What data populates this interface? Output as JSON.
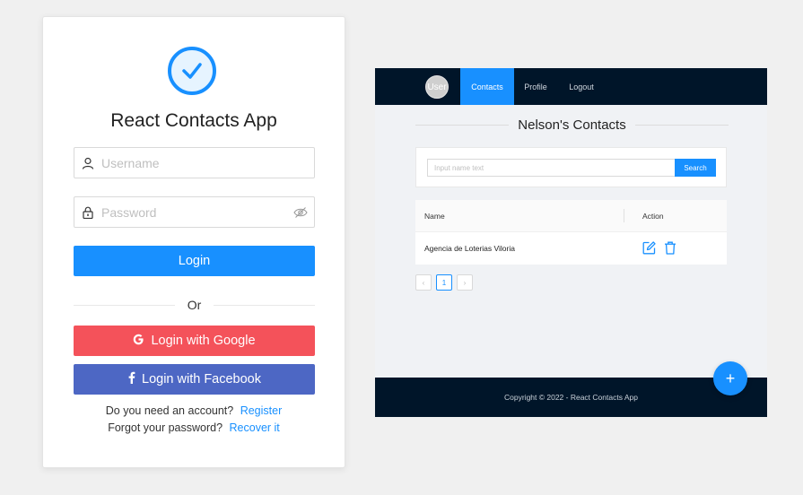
{
  "login": {
    "app_title": "React Contacts App",
    "username_placeholder": "Username",
    "password_placeholder": "Password",
    "login_label": "Login",
    "or_label": "Or",
    "google_label": "Login with Google",
    "facebook_label": "Login with Facebook",
    "register_question": "Do you need an account?",
    "register_link": "Register",
    "forgot_question": "Forgot your password?",
    "recover_link": "Recover it",
    "colors": {
      "primary": "#1890ff",
      "google": "#f4525a",
      "facebook": "#4d67c4"
    }
  },
  "contacts": {
    "nav": {
      "avatar_label": "User",
      "items": [
        {
          "label": "Contacts",
          "active": true
        },
        {
          "label": "Profile",
          "active": false
        },
        {
          "label": "Logout",
          "active": false
        }
      ]
    },
    "page_title": "Nelson's Contacts",
    "search": {
      "placeholder": "Input name text",
      "button_label": "Search"
    },
    "table": {
      "columns": [
        "Name",
        "Action"
      ],
      "rows": [
        {
          "name": "Agencia de Loterias Viloria",
          "actions": [
            "edit-icon",
            "delete-icon"
          ]
        }
      ]
    },
    "pagination": {
      "prev": "‹",
      "current": "1",
      "next": "›"
    },
    "footer_text": "Copyright © 2022 - React Contacts App",
    "fab_label": "+",
    "colors": {
      "navbar": "#001529",
      "accent": "#1890ff"
    }
  }
}
